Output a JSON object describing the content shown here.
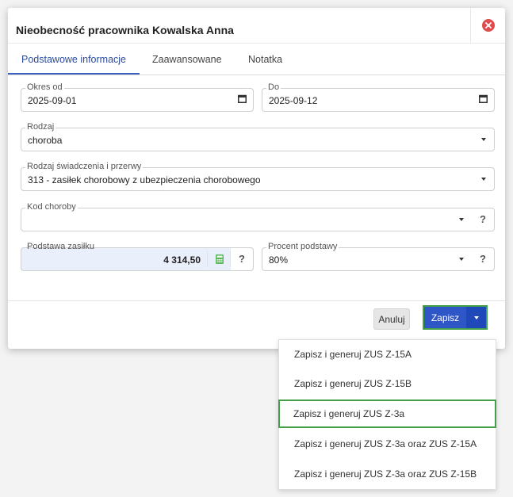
{
  "dialog": {
    "title": "Nieobecność pracownika Kowalska Anna"
  },
  "tabs": [
    {
      "label": "Podstawowe informacje",
      "active": true
    },
    {
      "label": "Zaawansowane",
      "active": false
    },
    {
      "label": "Notatka",
      "active": false
    }
  ],
  "fields": {
    "okres_od": {
      "label": "Okres od",
      "value": "2025-09-01",
      "icon": "calendar-icon"
    },
    "do": {
      "label": "Do",
      "value": "2025-09-12",
      "icon": "calendar-icon"
    },
    "rodzaj": {
      "label": "Rodzaj",
      "value": "choroba"
    },
    "rodzaj_swiadczenia": {
      "label": "Rodzaj świadczenia i przerwy",
      "value": "313 - zasiłek chorobowy z ubezpieczenia chorobowego"
    },
    "kod_choroby": {
      "label": "Kod choroby",
      "value": "",
      "help": "?"
    },
    "podstawa_zasilku": {
      "label": "Podstawa zasiłku",
      "value": "4 314,50",
      "icon": "calculator-icon",
      "help": "?"
    },
    "procent_podstawy": {
      "label": "Procent podstawy",
      "value": "80%",
      "help": "?"
    }
  },
  "footer": {
    "cancel_label": "Anuluj",
    "save_label": "Zapisz"
  },
  "save_menu": [
    "Zapisz i generuj ZUS Z-15A",
    "Zapisz i generuj ZUS Z-15B",
    "Zapisz i generuj ZUS Z-3a",
    "Zapisz i generuj ZUS Z-3a oraz ZUS Z-15A",
    "Zapisz i generuj ZUS Z-3a oraz ZUS Z-15B"
  ],
  "colors": {
    "primary": "#2f56c7",
    "highlight": "#43a047",
    "close": "#e04b4b",
    "readonly_field": "#e9effb"
  }
}
